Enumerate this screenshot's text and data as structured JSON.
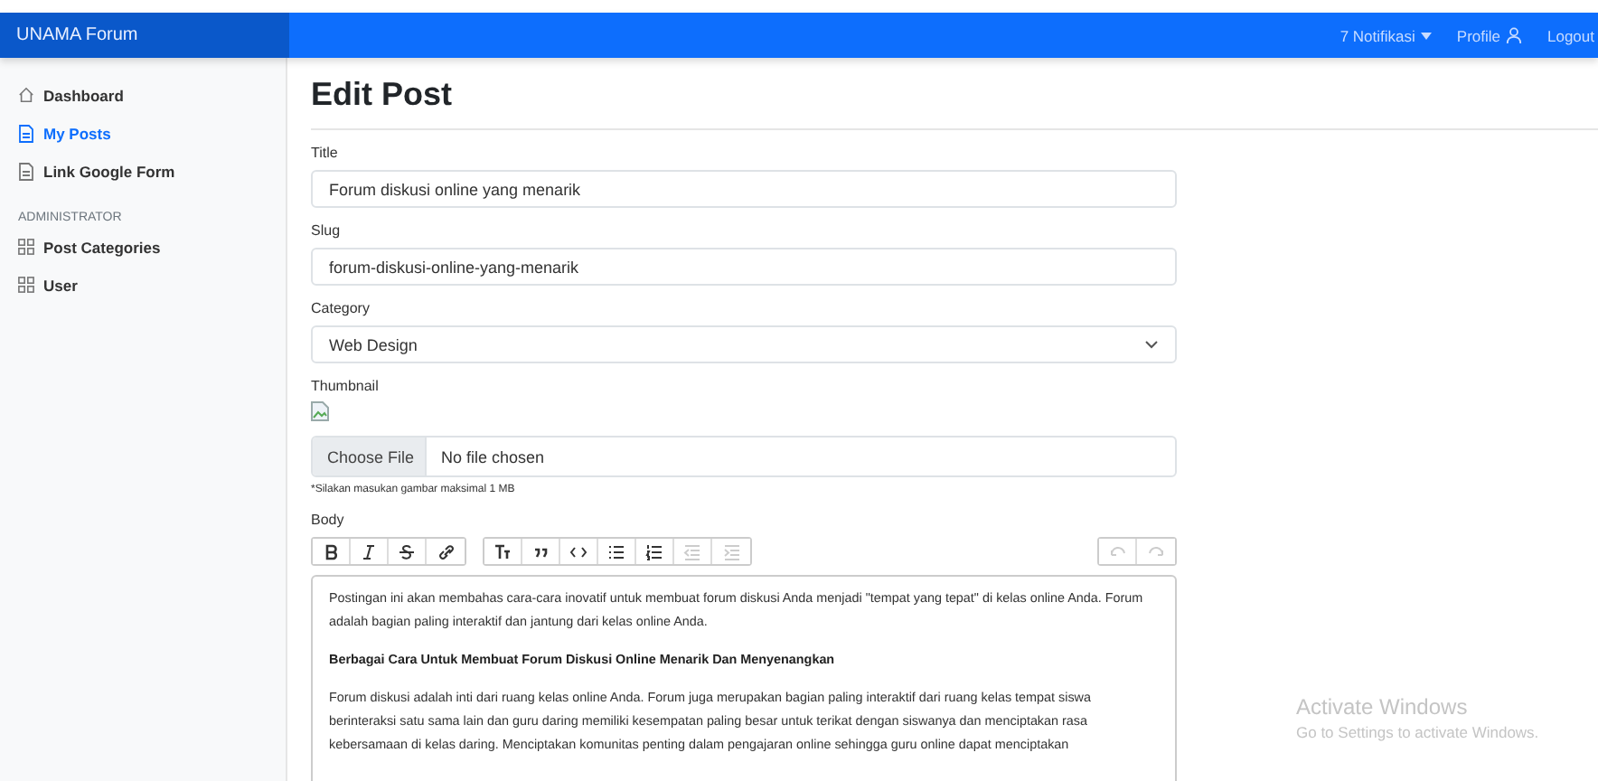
{
  "navbar": {
    "brand": "UNAMA Forum",
    "links": [
      {
        "label": "7 Notifikasi",
        "kind": "dropdown"
      },
      {
        "label": "Profile",
        "kind": "profile"
      },
      {
        "label": "Logout",
        "kind": "plain"
      }
    ]
  },
  "sidebar": {
    "items": [
      {
        "label": "Dashboard",
        "kind": "house",
        "selected": false
      },
      {
        "label": "My Posts",
        "kind": "document",
        "selected": true
      },
      {
        "label": "Link Google Form",
        "kind": "document",
        "selected": false
      }
    ],
    "section": "ADMINISTRATOR",
    "admin_items": [
      {
        "label": "Post Categories",
        "kind": "grid",
        "selected": false
      },
      {
        "label": "User",
        "kind": "grid",
        "selected": false
      }
    ]
  },
  "page_title": "Edit Post",
  "form": {
    "title": {
      "label": "Title",
      "value": "Forum diskusi online yang menarik"
    },
    "slug": {
      "label": "Slug",
      "value": "forum-diskusi-online-yang-menarik"
    },
    "category": {
      "label": "Category",
      "value": "Web Design"
    },
    "thumbnail": {
      "label": "Thumbnail",
      "button": "Choose File",
      "status": "No file chosen",
      "hint": "*Silakan masukan gambar maksimal 1 MB"
    },
    "body": {
      "label": "Body",
      "toolbar": [
        {
          "kind": "bold",
          "disabled": false
        },
        {
          "kind": "italic",
          "disabled": false
        },
        {
          "kind": "strike",
          "disabled": false
        },
        {
          "kind": "link",
          "disabled": false
        },
        {
          "kind": "heading",
          "disabled": false
        },
        {
          "kind": "quote",
          "disabled": false
        },
        {
          "kind": "code",
          "disabled": false
        },
        {
          "kind": "bullets",
          "disabled": false
        },
        {
          "kind": "numbers",
          "disabled": false
        },
        {
          "kind": "outdent",
          "disabled": true
        },
        {
          "kind": "indent",
          "disabled": true
        },
        {
          "kind": "undo",
          "disabled": true
        },
        {
          "kind": "redo",
          "disabled": true
        }
      ],
      "content": [
        {
          "kind": "paragraph",
          "text": "Postingan ini akan membahas cara-cara inovatif untuk membuat forum diskusi Anda menjadi \"tempat yang tepat\" di kelas online Anda. Forum adalah bagian paling interaktif dan jantung dari kelas online Anda."
        },
        {
          "kind": "heading",
          "text": "Berbagai Cara Untuk Membuat Forum Diskusi Online Menarik Dan Menyenangkan"
        },
        {
          "kind": "paragraph",
          "text": "Forum diskusi adalah inti dari ruang kelas online Anda. Forum juga merupakan bagian paling interaktif dari ruang kelas tempat siswa berinteraksi satu sama lain dan guru daring memiliki kesempatan paling besar untuk terikat dengan siswanya dan menciptakan rasa kebersamaan di kelas daring. Menciptakan komunitas penting dalam pengajaran online sehingga guru online dapat menciptakan"
        }
      ]
    }
  },
  "os_notice": {
    "title": "Activate Windows",
    "subtitle": "Go to Settings to activate Windows."
  }
}
